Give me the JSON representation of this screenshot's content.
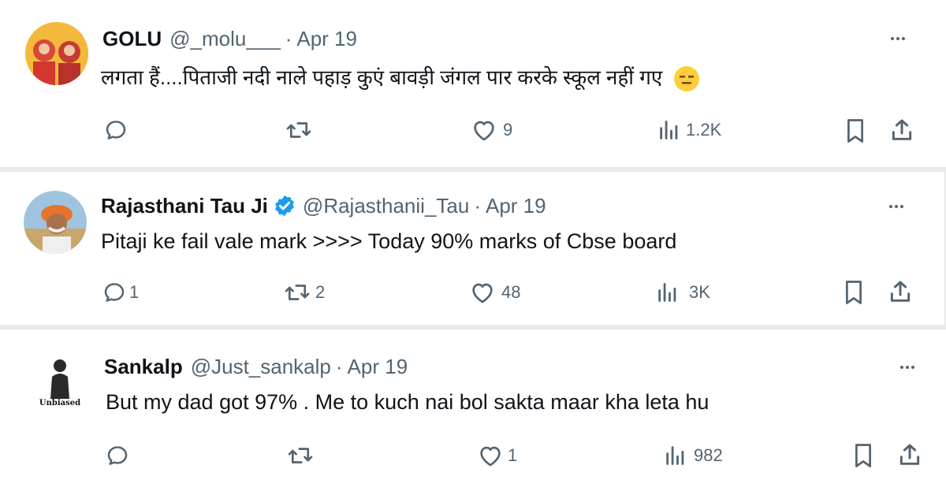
{
  "tweets": [
    {
      "name": "GOLU",
      "handle": "@_molu___",
      "separator": "·",
      "date": "Apr 19",
      "text": "लगता हैं....पिताजी नदी नाले पहाड़ कुएं बावड़ी जंगल पार करके स्कूल नहीं गए",
      "emoji": "expressionless-face",
      "replies": "",
      "retweets": "",
      "likes": "9",
      "views": "1.2K"
    },
    {
      "name": "Rajasthani Tau Ji",
      "verified": true,
      "handle": "@Rajasthanii_Tau",
      "separator": "·",
      "date": "Apr 19",
      "text": "Pitaji ke fail vale mark >>>> Today 90% marks of Cbse board",
      "replies": "1",
      "retweets": "2",
      "likes": "48",
      "views": "3K"
    },
    {
      "name": "Sankalp",
      "handle": "@Just_sankalp",
      "separator": "·",
      "date": "Apr 19",
      "avatar_text": "Unbiased",
      "text": "But my dad got 97% . Me to kuch nai bol sakta maar kha leta hu",
      "replies": "",
      "retweets": "",
      "likes": "1",
      "views": "982"
    }
  ],
  "icons": [
    "reply-icon",
    "retweet-icon",
    "like-icon",
    "views-icon",
    "bookmark-icon",
    "share-icon",
    "more-icon",
    "verified-badge-icon"
  ],
  "colors": {
    "text": "#0f1419",
    "secondary": "#536471",
    "verified": "#1d9bf0",
    "divider": "#e9e9e9"
  }
}
